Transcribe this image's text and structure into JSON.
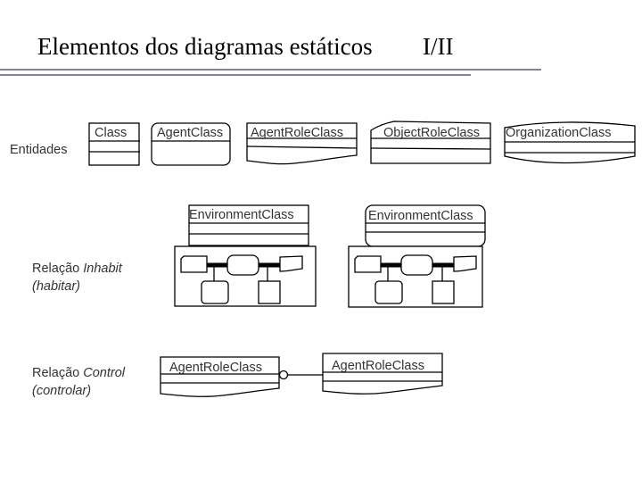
{
  "header": {
    "title": "Elementos dos diagramas estáticos",
    "page": "I/II"
  },
  "sections": {
    "entities_label": "Entidades",
    "inhabit": {
      "prefix": "Relação ",
      "term": "Inhabit",
      "translation": "(habitar)"
    },
    "control": {
      "prefix": "Relação ",
      "term": "Control",
      "translation": "(controlar)"
    }
  },
  "entities": [
    {
      "name": "Class",
      "shape": "rectangle"
    },
    {
      "name": "AgentClass",
      "shape": "rounded-rectangle"
    },
    {
      "name": "AgentRoleClass",
      "shape": "wavy-bottom-rectangle"
    },
    {
      "name": "ObjectRoleClass",
      "shape": "cut-corner-rectangle"
    },
    {
      "name": "OrganizationClass",
      "shape": "curved-top-bottom"
    }
  ],
  "inhabit_examples": [
    {
      "environment": "EnvironmentClass",
      "style": "rectangle"
    },
    {
      "environment": "EnvironmentClass",
      "style": "rounded-rectangle"
    }
  ],
  "control_example": {
    "controller": "AgentRoleClass",
    "controlled": "AgentRoleClass"
  }
}
